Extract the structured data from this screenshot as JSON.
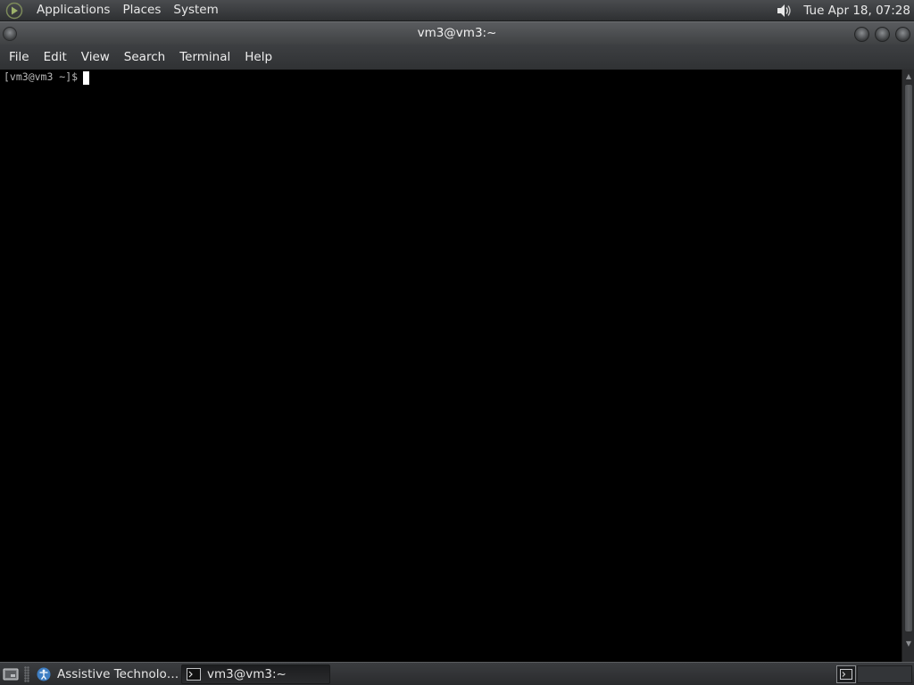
{
  "top_panel": {
    "menus": [
      "Applications",
      "Places",
      "System"
    ],
    "clock": "Tue Apr 18, 07:28",
    "icons": {
      "logo": "distro-logo-icon",
      "volume": "volume-icon"
    }
  },
  "window": {
    "title": "vm3@vm3:~"
  },
  "menubar": {
    "items": [
      "File",
      "Edit",
      "View",
      "Search",
      "Terminal",
      "Help"
    ]
  },
  "terminal": {
    "prompt": "[vm3@vm3 ~]$"
  },
  "taskbar": {
    "tasks": [
      {
        "label": "Assistive Technologi…",
        "icon": "accessibility-icon",
        "active": false
      },
      {
        "label": "vm3@vm3:~",
        "icon": "terminal-icon",
        "active": true
      }
    ]
  },
  "colors": {
    "terminal_bg": "#000000",
    "terminal_fg": "#b8b8b8",
    "panel_bg": "#3a3c3f"
  }
}
